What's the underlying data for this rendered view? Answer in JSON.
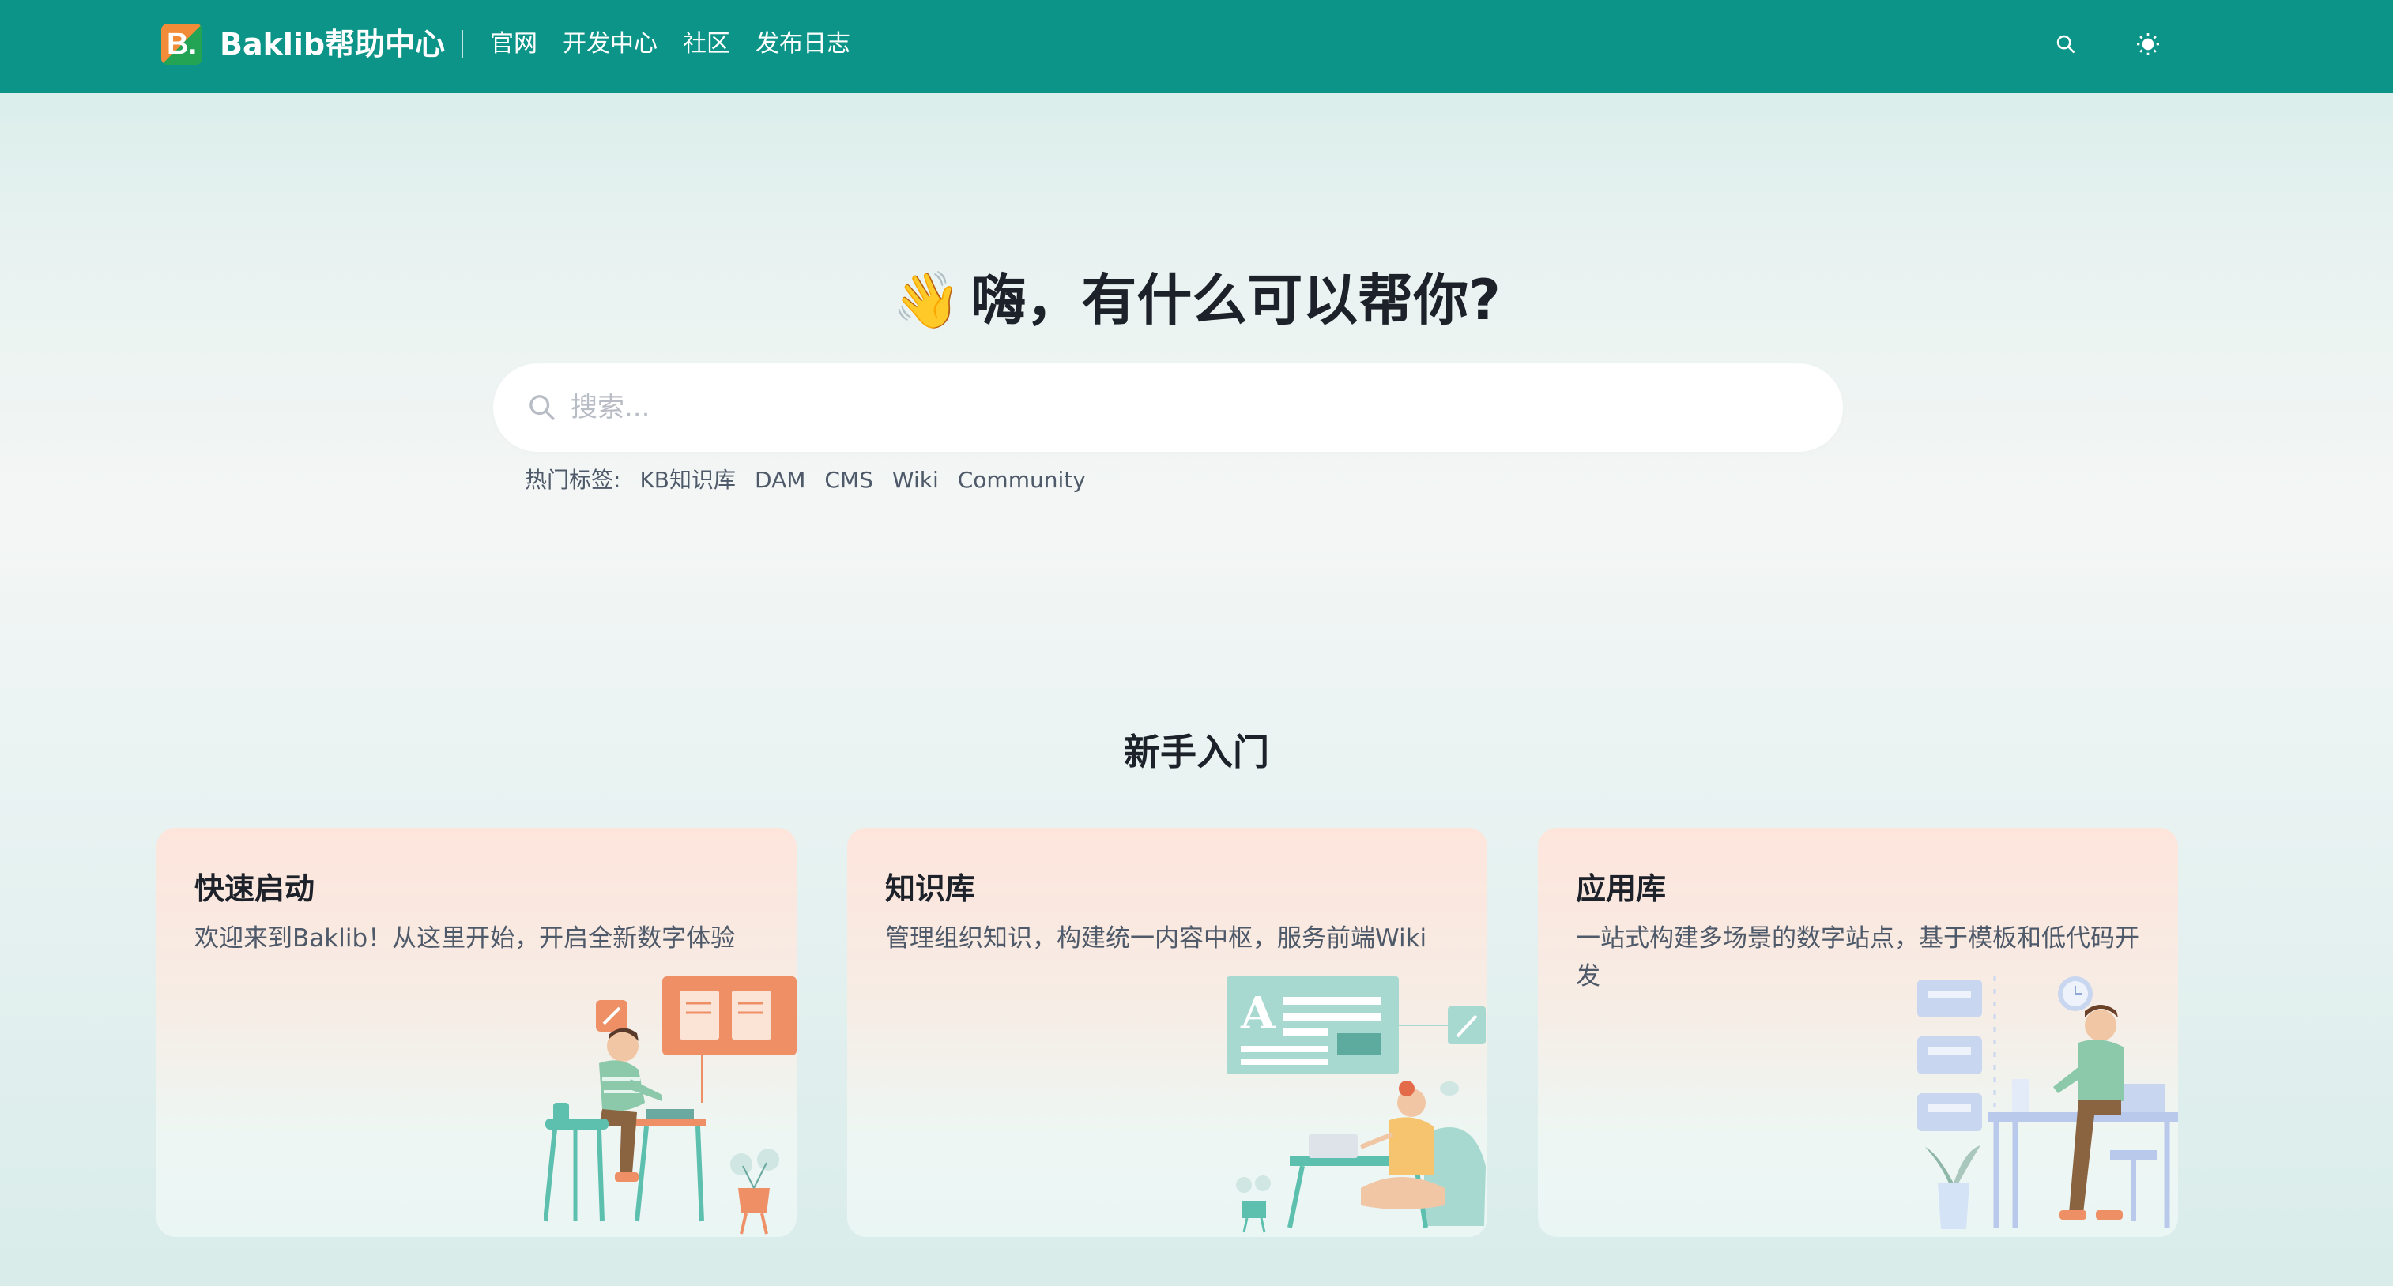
{
  "header": {
    "logo_letter": "B.",
    "brand": "Baklib帮助中心",
    "nav": [
      "官网",
      "开发中心",
      "社区",
      "发布日志"
    ],
    "icons": {
      "search": "search-icon",
      "theme": "sun-icon"
    },
    "bg_color": "#0c9488"
  },
  "hero": {
    "emoji": "👋",
    "title": "嗨，有什么可以帮你?",
    "search_placeholder": "搜索...",
    "tags_label": "热门标签:",
    "tags": [
      "KB知识库",
      "DAM",
      "CMS",
      "Wiki",
      "Community"
    ]
  },
  "section": {
    "title": "新手入门",
    "cards": [
      {
        "title": "快速启动",
        "desc": "欢迎来到Baklib！从这里开始，开启全新数字体验"
      },
      {
        "title": "知识库",
        "desc": "管理组织知识，构建统一内容中枢，服务前端Wiki"
      },
      {
        "title": "应用库",
        "desc": "一站式构建多场景的数字站点，基于模板和低代码开发"
      }
    ]
  }
}
